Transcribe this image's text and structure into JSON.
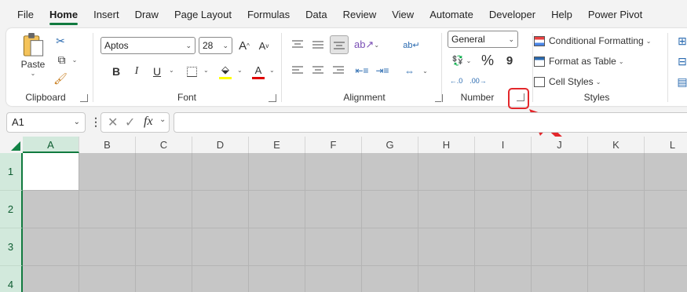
{
  "menu": {
    "tabs": [
      {
        "label": "File"
      },
      {
        "label": "Home",
        "active": true
      },
      {
        "label": "Insert"
      },
      {
        "label": "Draw"
      },
      {
        "label": "Page Layout"
      },
      {
        "label": "Formulas"
      },
      {
        "label": "Data"
      },
      {
        "label": "Review"
      },
      {
        "label": "View"
      },
      {
        "label": "Automate"
      },
      {
        "label": "Developer"
      },
      {
        "label": "Help"
      },
      {
        "label": "Power Pivot"
      }
    ]
  },
  "ribbon": {
    "clipboard": {
      "label": "Clipboard",
      "paste_label": "Paste"
    },
    "font": {
      "label": "Font",
      "font_name": "Aptos",
      "font_size": "28",
      "bold": "B",
      "italic": "I",
      "underline": "U"
    },
    "alignment": {
      "label": "Alignment"
    },
    "number": {
      "label": "Number",
      "format": "General",
      "percent": "%",
      "comma": "9"
    },
    "styles": {
      "label": "Styles",
      "conditional_formatting": "Conditional Formatting",
      "format_as_table": "Format as Table",
      "cell_styles": "Cell Styles"
    }
  },
  "formula_bar": {
    "name_box": "A1",
    "fx": "fx",
    "formula": ""
  },
  "sheet": {
    "columns": [
      "A",
      "B",
      "C",
      "D",
      "E",
      "F",
      "G",
      "H",
      "I",
      "J",
      "K",
      "L"
    ],
    "rows": [
      "1",
      "2",
      "3",
      "4"
    ],
    "active_cell": "A1"
  },
  "colors": {
    "accent": "#117a3f",
    "annotation": "#e3272b",
    "cell_fill": "#c6c6c6"
  }
}
